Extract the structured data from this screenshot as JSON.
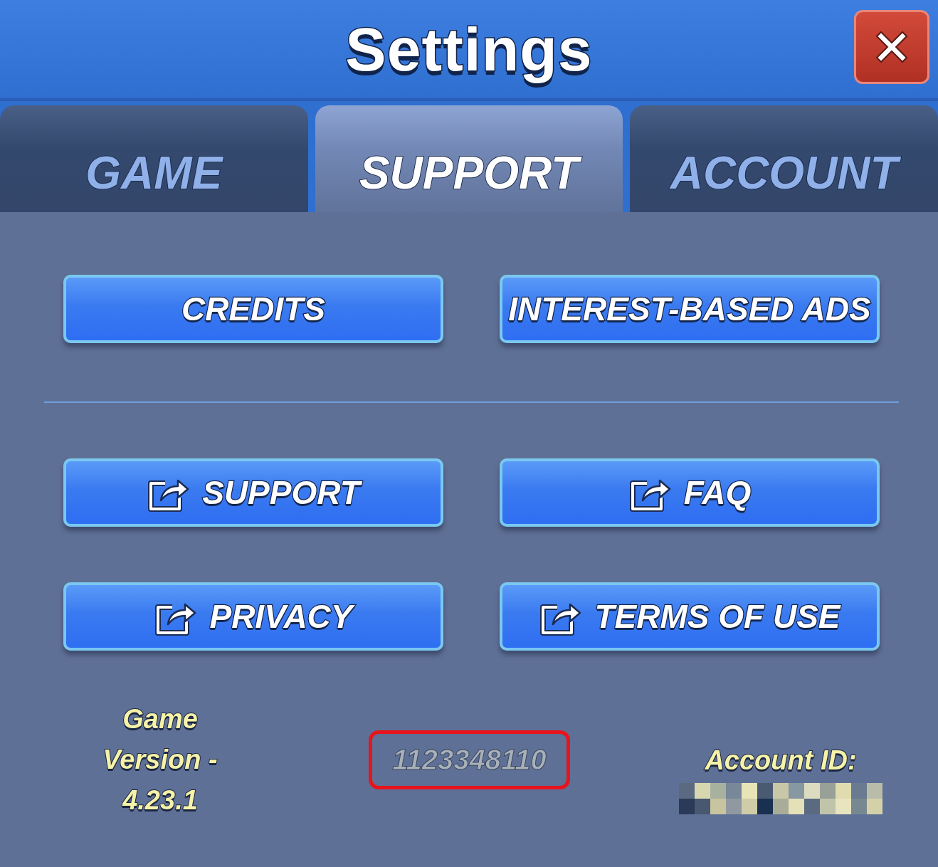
{
  "window": {
    "title": "Settings"
  },
  "tabs": [
    {
      "label": "GAME",
      "selected": false
    },
    {
      "label": "SUPPORT",
      "selected": true
    },
    {
      "label": "ACCOUNT",
      "selected": false
    }
  ],
  "button_rows": [
    [
      {
        "label": "CREDITS",
        "external_link": false
      },
      {
        "label": "INTEREST-BASED ADS",
        "external_link": false
      }
    ],
    [
      {
        "label": "SUPPORT",
        "external_link": true
      },
      {
        "label": "FAQ",
        "external_link": true
      }
    ],
    [
      {
        "label": "PRIVACY",
        "external_link": true
      },
      {
        "label": "TERMS OF USE",
        "external_link": true
      }
    ]
  ],
  "footer": {
    "version": "Game Version - 4.23.1",
    "player_number": {
      "text": "1123348110",
      "highlighted": true
    },
    "account_label": "Account ID:",
    "account_id": {
      "kind": "redacted"
    }
  }
}
